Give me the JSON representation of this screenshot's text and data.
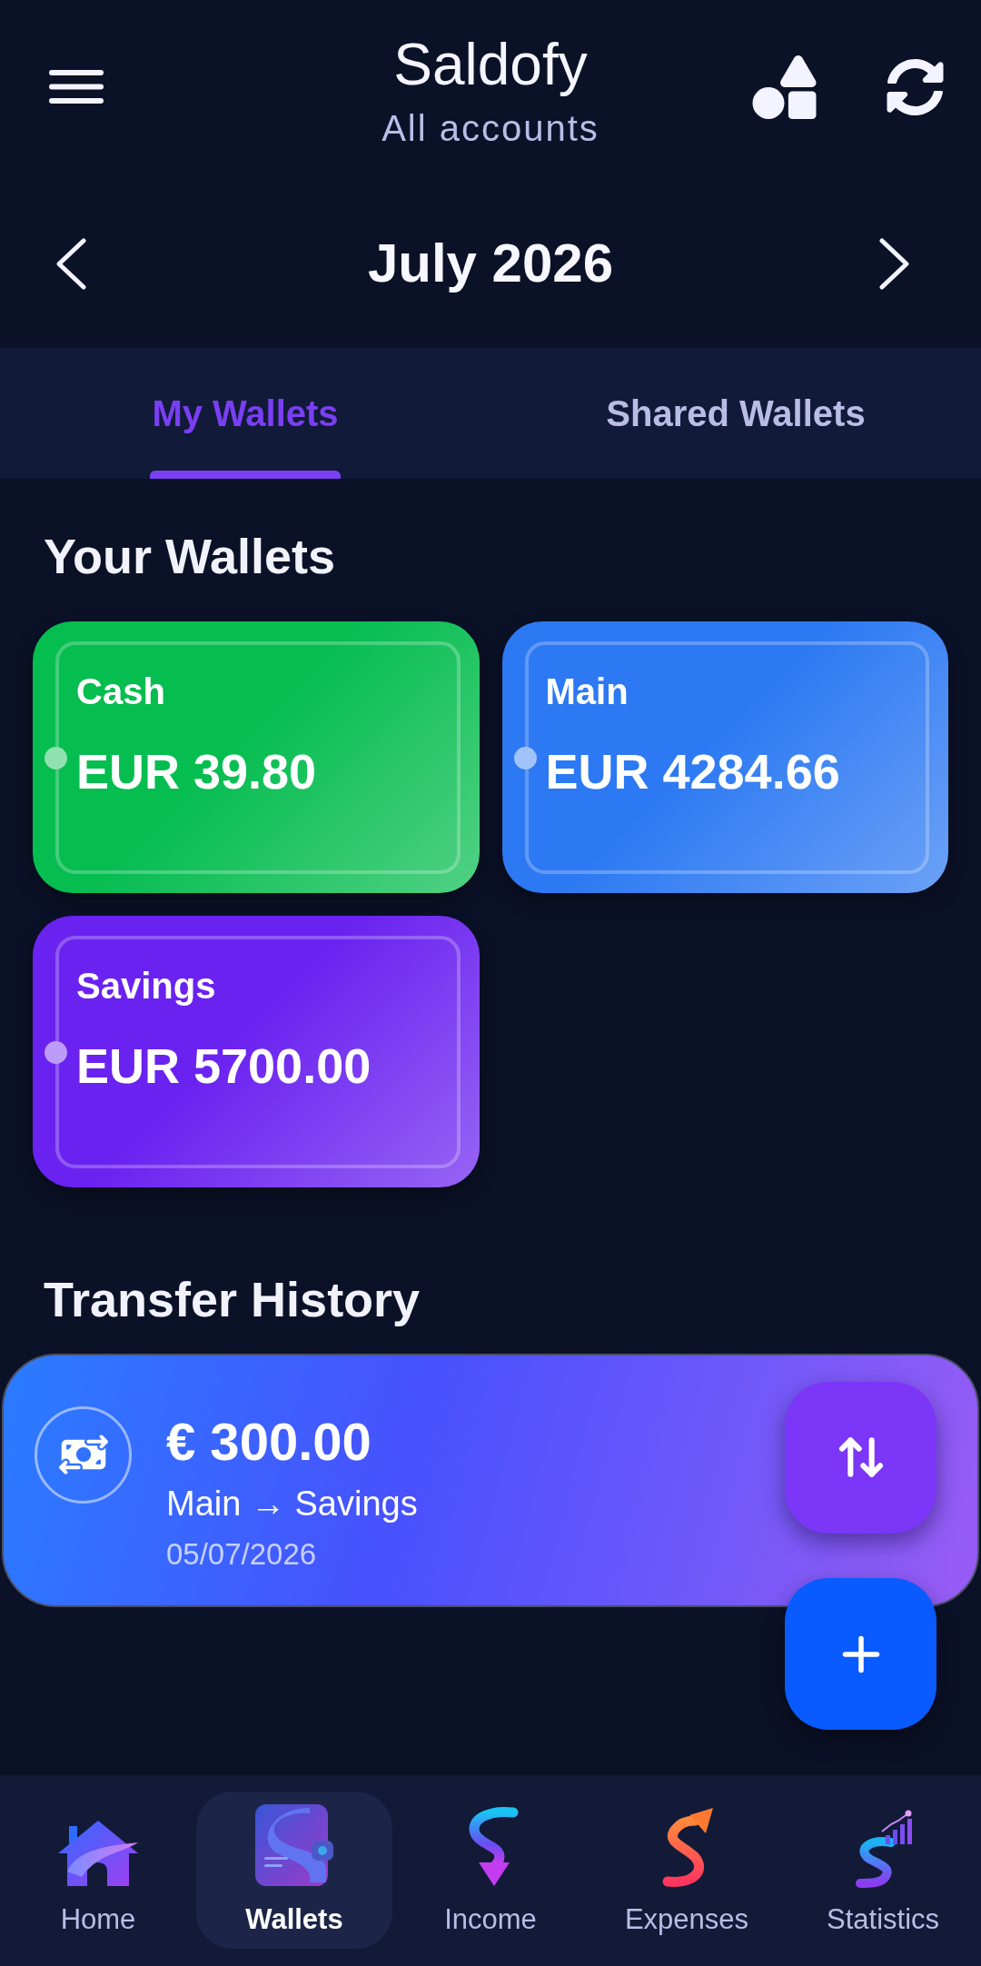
{
  "header": {
    "title": "Saldofy",
    "subtitle": "All accounts"
  },
  "month_nav": {
    "label": "July 2026"
  },
  "tabs": [
    {
      "label": "My Wallets",
      "selected": true
    },
    {
      "label": "Shared Wallets",
      "selected": false
    }
  ],
  "wallets_section": {
    "title": "Your Wallets",
    "wallets": [
      {
        "name": "Cash",
        "balance": "EUR 39.80",
        "color": "#06bd50"
      },
      {
        "name": "Main",
        "balance": "EUR 4284.66",
        "color": "#2c79f3"
      },
      {
        "name": "Savings",
        "balance": "EUR 5700.00",
        "color": "#6a22f0"
      }
    ]
  },
  "transfers_section": {
    "title": "Transfer History",
    "transfers": [
      {
        "amount": "€ 300.00",
        "route": "Main → Savings",
        "date": "05/07/2026"
      }
    ]
  },
  "bottom_nav": [
    {
      "kind": "home",
      "label": "Home",
      "selected": false
    },
    {
      "kind": "wallets",
      "label": "Wallets",
      "selected": true
    },
    {
      "kind": "income",
      "label": "Income",
      "selected": false
    },
    {
      "kind": "expenses",
      "label": "Expenses",
      "selected": false
    },
    {
      "kind": "statistics",
      "label": "Statistics",
      "selected": false
    }
  ]
}
